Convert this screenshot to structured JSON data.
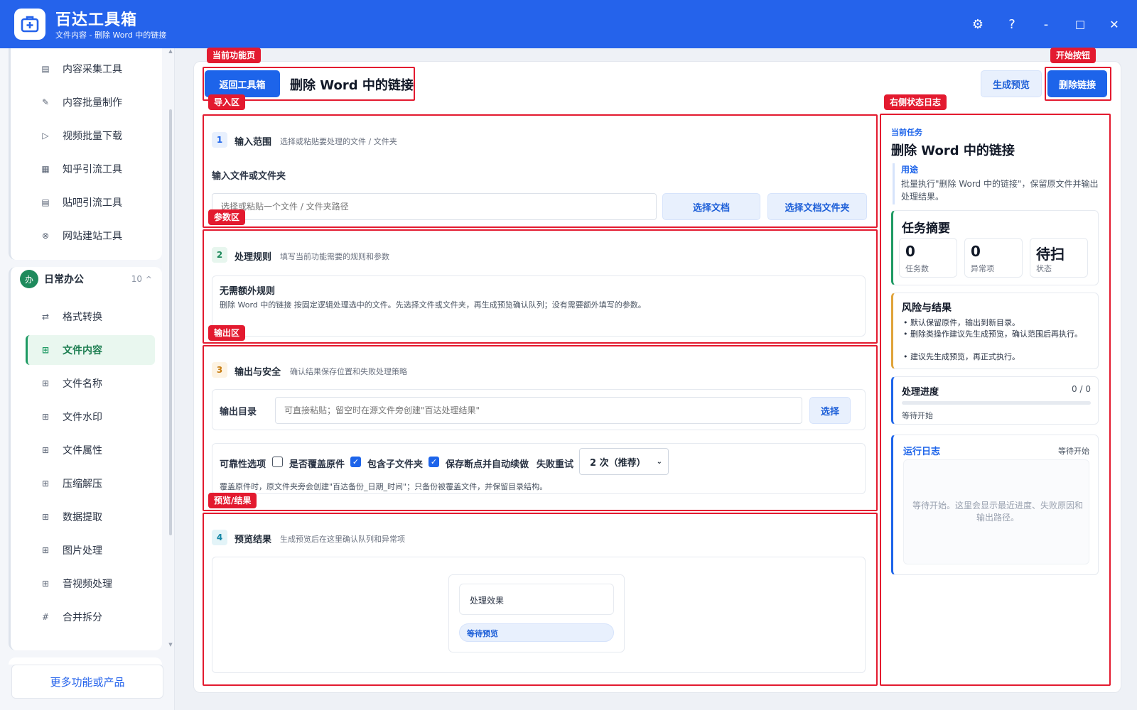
{
  "app": {
    "title": "百达工具箱",
    "subtitle": "文件内容 - 删除 Word 中的链接"
  },
  "window_controls": {
    "settings": "⚙",
    "help": "?",
    "minimize": "-",
    "maximize": "□",
    "close": "✕"
  },
  "sidebar": {
    "top_items": [
      {
        "label": "内容采集工具",
        "icon": "▤"
      },
      {
        "label": "内容批量制作",
        "icon": "✎"
      },
      {
        "label": "视频批量下载",
        "icon": "▷"
      },
      {
        "label": "知乎引流工具",
        "icon": "▦"
      },
      {
        "label": "贴吧引流工具",
        "icon": "▤"
      },
      {
        "label": "网站建站工具",
        "icon": "⊗"
      }
    ],
    "group": {
      "badge": "办",
      "name": "日常办公",
      "count": "10",
      "caret": "^"
    },
    "group_items": [
      {
        "label": "格式转换",
        "icon": "⇄"
      },
      {
        "label": "文件内容",
        "icon": "⊞"
      },
      {
        "label": "文件名称",
        "icon": "⊞"
      },
      {
        "label": "文件水印",
        "icon": "⊞"
      },
      {
        "label": "文件属性",
        "icon": "⊞"
      },
      {
        "label": "压缩解压",
        "icon": "⊞"
      },
      {
        "label": "数据提取",
        "icon": "⊞"
      },
      {
        "label": "图片处理",
        "icon": "⊞"
      },
      {
        "label": "音视频处理",
        "icon": "⊞"
      },
      {
        "label": "合并拆分",
        "icon": "#"
      }
    ],
    "more_button": "更多功能或产品"
  },
  "header": {
    "back_button": "返回工具箱",
    "page_title": "删除 Word 中的链接",
    "preview_button": "生成预览",
    "start_button": "删除链接"
  },
  "annotations": {
    "current_page": "当前功能页",
    "start_button": "开始按钮",
    "import_area": "导入区",
    "right_log": "右侧状态日志",
    "param_area": "参数区",
    "output_area": "输出区",
    "preview_area": "预览/结果"
  },
  "step1": {
    "num": "1",
    "title": "输入范围",
    "desc": "选择或粘贴要处理的文件 / 文件夹",
    "field_label": "输入文件或文件夹",
    "placeholder": "选择或粘贴一个文件 / 文件夹路径",
    "choose_doc": "选择文档",
    "choose_folder": "选择文档文件夹"
  },
  "step2": {
    "num": "2",
    "title": "处理规则",
    "desc": "填写当前功能需要的规则和参数",
    "rule_title": "无需额外规则",
    "rule_text": "删除 Word 中的链接 按固定逻辑处理选中的文件。先选择文件或文件夹，再生成预览确认队列；没有需要额外填写的参数。"
  },
  "step3": {
    "num": "3",
    "title": "输出与安全",
    "desc": "确认结果保存位置和失败处理策略",
    "output_label": "输出目录",
    "output_placeholder": "可直接粘贴；留空时在源文件旁创建\"百达处理结果\"",
    "choose_button": "选择",
    "reliability_label": "可靠性选项",
    "overwrite_label": "是否覆盖原件",
    "overwrite_checked": false,
    "subfolder_label": "包含子文件夹",
    "subfolder_checked": true,
    "resume_label": "保存断点并自动续做",
    "resume_checked": true,
    "retry_label": "失败重试",
    "retry_value": "2 次（推荐）",
    "note": "覆盖原件时，原文件夹旁会创建\"百达备份_日期_时间\"；只备份被覆盖文件，并保留目录结构。"
  },
  "step4": {
    "num": "4",
    "title": "预览结果",
    "desc": "生成预览后在这里确认队列和异常项",
    "effect_label": "处理效果",
    "waiting_label": "等待预览"
  },
  "right_panel": {
    "current_task_label": "当前任务",
    "current_task_title": "删除 Word 中的链接",
    "purpose_label": "用途",
    "purpose_text": "批量执行\"删除 Word 中的链接\"，保留原文件并输出处理结果。",
    "summary_title": "任务摘要",
    "stats": [
      {
        "value": "0",
        "label": "任务数"
      },
      {
        "value": "0",
        "label": "异常项"
      },
      {
        "value": "待扫",
        "label": "状态"
      }
    ],
    "risk_title": "风险与结果",
    "risk_items": [
      "默认保留原件，输出到新目录。",
      "删除类操作建议先生成预览，确认范围后再执行。",
      "建议先生成预览，再正式执行。"
    ],
    "progress_title": "处理进度",
    "progress_count": "0 / 0",
    "progress_value": 0,
    "progress_status": "等待开始",
    "log_title": "运行日志",
    "log_status": "等待开始",
    "log_placeholder": "等待开始。这里会显示最近进度、失败原因和输出路径。"
  },
  "colors": {
    "brand": "#2563eb",
    "primary_button": "#1d64ea",
    "annotation_red": "#e31a2f",
    "active_green": "#1e9a63"
  }
}
